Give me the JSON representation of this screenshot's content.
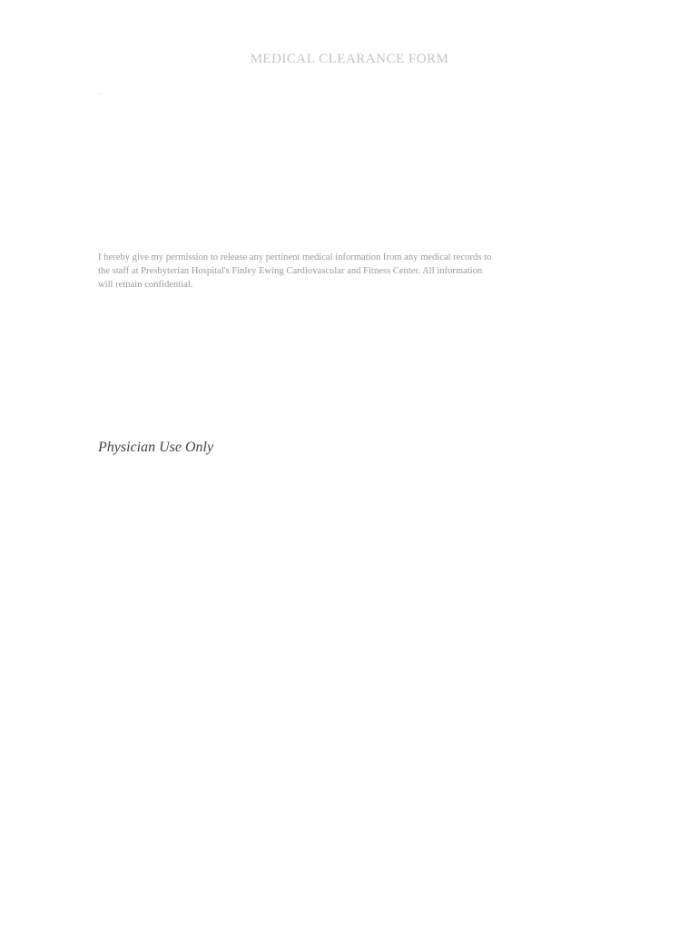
{
  "form": {
    "title": "MEDICAL CLEARANCE FORM",
    "consent_line1": "I hereby give my permission to release any pertinent medical information from any medical records to",
    "consent_line2": "the staff at Presbyterian Hospital's Finley Ewing Cardiovascular and Fitness Center.  All information",
    "consent_line3": "will remain confidential.",
    "physician_heading": "Physician Use Only"
  }
}
